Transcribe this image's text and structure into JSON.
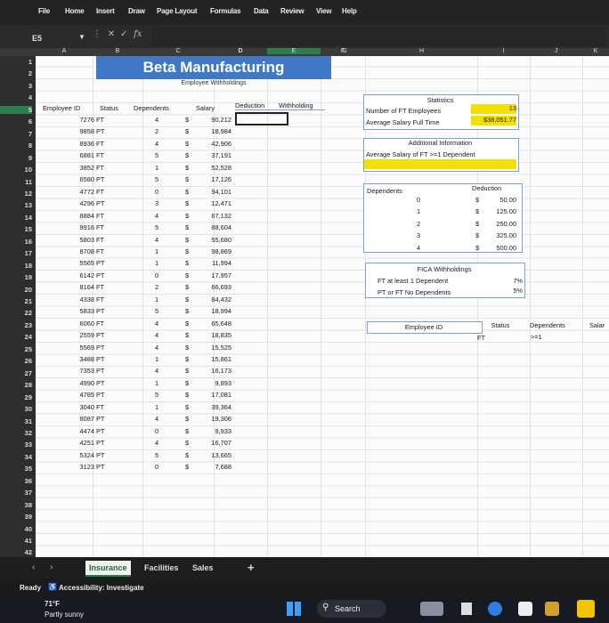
{
  "menu": [
    "File",
    "Home",
    "Insert",
    "Draw",
    "Page Layout",
    "Formulas",
    "Data",
    "Review",
    "View",
    "Help"
  ],
  "name_box": "E5",
  "fx": "fx",
  "columns": [
    "A",
    "B",
    "C",
    "D",
    "E",
    "F",
    "G",
    "H",
    "I",
    "J",
    "K"
  ],
  "rows": [
    "1",
    "2",
    "3",
    "4",
    "5",
    "6",
    "7",
    "8",
    "9",
    "10",
    "11",
    "12",
    "13",
    "14",
    "15",
    "16",
    "17",
    "18",
    "19",
    "20",
    "21",
    "22",
    "23",
    "24",
    "25",
    "26",
    "27",
    "28",
    "29",
    "30",
    "31",
    "32",
    "33",
    "34",
    "35",
    "36",
    "37",
    "38",
    "39",
    "40",
    "41",
    "42"
  ],
  "sheet": {
    "title": "Beta Manufacturing",
    "subtitle": "Employee Withholdings",
    "headers": [
      "Employee ID",
      "Status",
      "Dependents",
      "Salary",
      "Deduction",
      "Withholding"
    ],
    "employees": [
      [
        "7276",
        "FT",
        "4",
        "$",
        "90,212"
      ],
      [
        "9858",
        "PT",
        "2",
        "$",
        "18,984"
      ],
      [
        "8936",
        "FT",
        "4",
        "$",
        "42,906"
      ],
      [
        "6881",
        "FT",
        "5",
        "$",
        "37,191"
      ],
      [
        "3852",
        "FT",
        "1",
        "$",
        "52,528"
      ],
      [
        "6580",
        "PT",
        "5",
        "$",
        "17,126"
      ],
      [
        "4772",
        "FT",
        "0",
        "$",
        "94,101"
      ],
      [
        "4296",
        "PT",
        "3",
        "$",
        "12,471"
      ],
      [
        "8884",
        "FT",
        "4",
        "$",
        "67,132"
      ],
      [
        "9916",
        "FT",
        "5",
        "$",
        "88,604"
      ],
      [
        "5803",
        "FT",
        "4",
        "$",
        "55,680"
      ],
      [
        "8708",
        "FT",
        "1",
        "$",
        "98,869"
      ],
      [
        "5565",
        "PT",
        "1",
        "$",
        "11,994"
      ],
      [
        "6142",
        "PT",
        "0",
        "$",
        "17,957"
      ],
      [
        "8164",
        "FT",
        "2",
        "$",
        "66,693"
      ],
      [
        "4338",
        "FT",
        "1",
        "$",
        "84,432"
      ],
      [
        "5833",
        "PT",
        "5",
        "$",
        "18,994"
      ],
      [
        "6060",
        "FT",
        "4",
        "$",
        "65,648"
      ],
      [
        "2559",
        "PT",
        "4",
        "$",
        "18,835"
      ],
      [
        "5569",
        "PT",
        "4",
        "$",
        "15,525"
      ],
      [
        "3488",
        "PT",
        "1",
        "$",
        "15,861"
      ],
      [
        "7353",
        "PT",
        "4",
        "$",
        "16,173"
      ],
      [
        "4990",
        "PT",
        "1",
        "$",
        "9,893"
      ],
      [
        "4785",
        "PT",
        "5",
        "$",
        "17,081"
      ],
      [
        "3040",
        "FT",
        "1",
        "$",
        "39,364"
      ],
      [
        "8087",
        "PT",
        "4",
        "$",
        "19,306"
      ],
      [
        "4474",
        "PT",
        "0",
        "$",
        "9,933"
      ],
      [
        "4251",
        "PT",
        "4",
        "$",
        "16,707"
      ],
      [
        "5324",
        "PT",
        "5",
        "$",
        "13,665"
      ],
      [
        "3123",
        "PT",
        "0",
        "$",
        "7,688"
      ]
    ],
    "statistics": {
      "title": "Statistics",
      "rows": [
        {
          "label": "Number of FT Employees",
          "value": "13"
        },
        {
          "label": "Average Salary Full Time",
          "value": "$38,051.77"
        }
      ]
    },
    "additional": {
      "title": "Additional Information",
      "label": "Average Salary of FT >=1 Dependent"
    },
    "deductions": {
      "headers": [
        "Dependents",
        "Deduction"
      ],
      "rows": [
        [
          "0",
          "$",
          "50.00"
        ],
        [
          "1",
          "$",
          "125.00"
        ],
        [
          "2",
          "$",
          "250.00"
        ],
        [
          "3",
          "$",
          "325.00"
        ],
        [
          "4",
          "$",
          "500.00"
        ]
      ]
    },
    "fica": {
      "title": "FICA Withholdings",
      "rows": [
        {
          "label": "FT at least 1 Dependent",
          "value": "7%"
        },
        {
          "label": "PT or FT No Dependents",
          "value": "5%"
        }
      ]
    },
    "criteria": {
      "headers": [
        "Employee ID",
        "Status",
        "Dependents",
        "Salar"
      ],
      "status": "FT",
      "dependents": ">=1"
    }
  },
  "tabs": [
    "Insurance",
    "Facilities",
    "Sales"
  ],
  "add_tab": "+",
  "status": {
    "ready": "Ready",
    "accessibility": "Accessibility: Investigate"
  },
  "weather": {
    "temp": "71°F",
    "desc": "Partly sunny"
  },
  "search": "Search",
  "colors": {
    "title_bg": "#3f78c7",
    "highlight": "#f4e000",
    "box_border": "#7fa0c9"
  }
}
